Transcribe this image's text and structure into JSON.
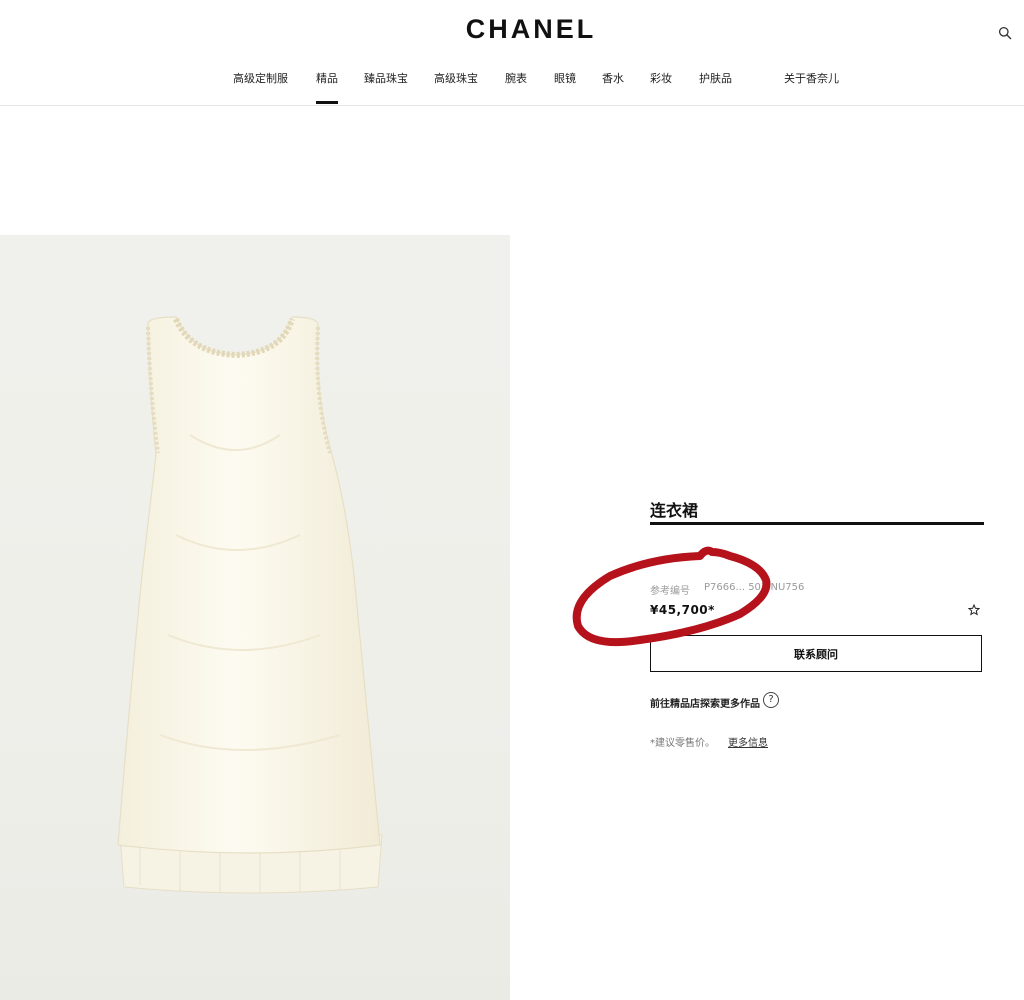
{
  "header": {
    "brand": "CHANEL",
    "search_icon": "search-icon",
    "nav": [
      {
        "label": "高级定制服"
      },
      {
        "label": "精品",
        "active": true
      },
      {
        "label": "臻品珠宝"
      },
      {
        "label": "高级珠宝"
      },
      {
        "label": "腕表"
      },
      {
        "label": "眼镜"
      },
      {
        "label": "香水"
      },
      {
        "label": "彩妆"
      },
      {
        "label": "护肤品"
      },
      {
        "label": "关于香奈儿"
      }
    ]
  },
  "product": {
    "image_icon": "dress-image",
    "title": "连衣裙",
    "ref_label": "参考编号",
    "ref_value": "P7666... 503 NU756",
    "price": "¥45,700*",
    "wishlist_icon": "star-icon",
    "contact_label": "联系顾问",
    "boutique_link": "前往精品店探索更多作品",
    "help_icon": "question-icon",
    "note": "*建议零售价。",
    "more_info": "更多信息"
  },
  "colors": {
    "accent": "#111111",
    "marker": "#b5121b",
    "image_bg": "#efefea",
    "dress": "#fbf8ec"
  }
}
